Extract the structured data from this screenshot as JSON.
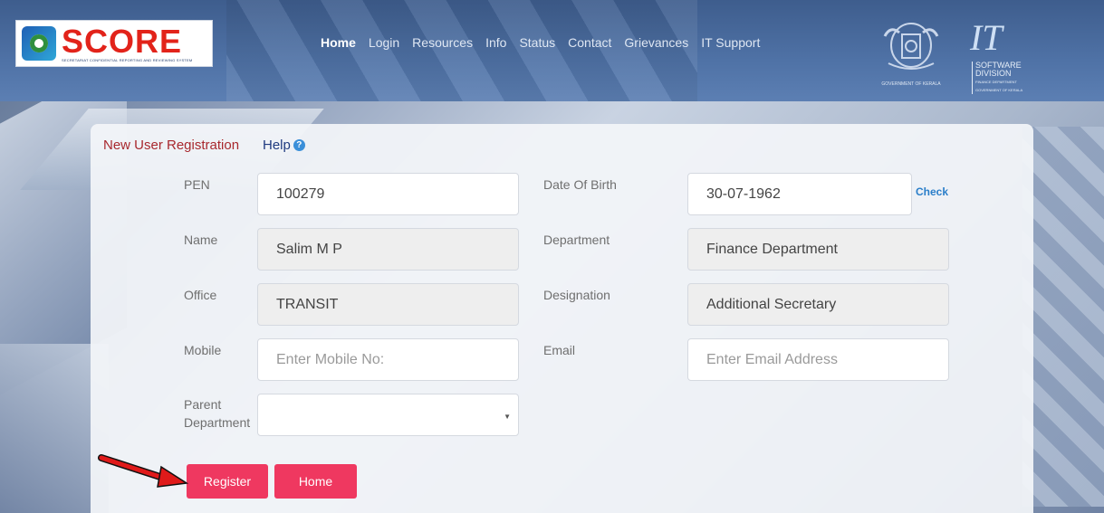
{
  "header": {
    "logo": {
      "title": "SCORE",
      "subtitle": "SECRETARIAT CONFIDENTIAL REPORTING AND REVIEWING SYSTEM"
    },
    "nav": [
      "Home",
      "Login",
      "Resources",
      "Info",
      "Status",
      "Contact",
      "Grievances",
      "IT Support"
    ],
    "active_nav": "Home",
    "gov_logo_text": "GOVERNMENT OF KERALA",
    "it_logo": {
      "letters": "IT",
      "line1": "SOFTWARE",
      "line2": "DIVISION",
      "line3": "FINANCE DEPARTMENT",
      "line4": "GOVERNMENT OF KERALA"
    }
  },
  "form": {
    "title": "New User Registration",
    "help_label": "Help",
    "help_icon": "question-icon",
    "check_label": "Check",
    "fields": {
      "pen": {
        "label": "PEN",
        "value": "100279"
      },
      "dob": {
        "label": "Date Of Birth",
        "value": "30-07-1962"
      },
      "name": {
        "label": "Name",
        "value": "Salim M P"
      },
      "department": {
        "label": "Department",
        "value": "Finance Department"
      },
      "office": {
        "label": "Office",
        "value": "TRANSIT"
      },
      "designation": {
        "label": "Designation",
        "value": "Additional Secretary"
      },
      "mobile": {
        "label": "Mobile",
        "placeholder": "Enter Mobile No:"
      },
      "email": {
        "label": "Email",
        "placeholder": "Enter Email Address"
      },
      "parent_department": {
        "label_line1": "Parent",
        "label_line2": "Department",
        "value": ""
      }
    },
    "buttons": {
      "register": "Register",
      "home": "Home"
    }
  },
  "colors": {
    "accent_button": "#ef3860",
    "title_red": "#a8282e",
    "header_blue": "#4f72a6"
  }
}
